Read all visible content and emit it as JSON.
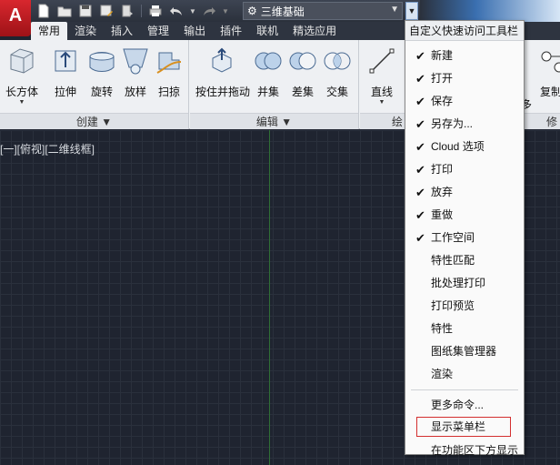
{
  "app": {
    "logo_text": "A"
  },
  "qat": {
    "icons": [
      "new-file-icon",
      "open-folder-icon",
      "save-icon",
      "save-as-icon",
      "publish-icon",
      "print-icon",
      "undo-icon",
      "redo-icon"
    ],
    "workspace_value": "三维基础",
    "menu_arrow": "▼"
  },
  "tabs": [
    "常用",
    "渲染",
    "插入",
    "管理",
    "输出",
    "插件",
    "联机",
    "精选应用"
  ],
  "tabs_active": 0,
  "ribbon": {
    "tools": {
      "box": "长方体",
      "extrude": "拉伸",
      "revolve": "旋转",
      "loft": "放样",
      "sweep": "扫掠",
      "presspull": "按住并拖动",
      "union": "并集",
      "subtract": "差集",
      "intersect": "交集",
      "line": "直线",
      "more": "多",
      "copy": "复制"
    },
    "panels": {
      "create": "创建 ▼",
      "edit": "编辑 ▼",
      "draw": "绘",
      "modify": "修"
    }
  },
  "viewport": {
    "label": "[一][俯视][二维线框]"
  },
  "dropdown": {
    "header": "自定义快速访问工具栏",
    "items": [
      {
        "label": "新建",
        "checked": "✔"
      },
      {
        "label": "打开",
        "checked": "✔"
      },
      {
        "label": "保存",
        "checked": "✔"
      },
      {
        "label": "另存为...",
        "checked": "✔"
      },
      {
        "label": "Cloud 选项",
        "checked": "✔"
      },
      {
        "label": "打印",
        "checked": "✔"
      },
      {
        "label": "放弃",
        "checked": "✔"
      },
      {
        "label": "重做",
        "checked": "✔"
      },
      {
        "label": "工作空间",
        "checked": "✔"
      },
      {
        "label": "特性匹配",
        "checked": ""
      },
      {
        "label": "批处理打印",
        "checked": ""
      },
      {
        "label": "打印预览",
        "checked": ""
      },
      {
        "label": "特性",
        "checked": ""
      },
      {
        "label": "图纸集管理器",
        "checked": ""
      },
      {
        "label": "渲染",
        "checked": ""
      }
    ],
    "more_commands": "更多命令...",
    "show_menubar": "显示菜单栏",
    "show_below_ribbon": "在功能区下方显示"
  },
  "colors": {
    "highlight_box": "#d32f2f",
    "axis_green": "#2f6f35",
    "canvas_bg": "#1f2430"
  }
}
